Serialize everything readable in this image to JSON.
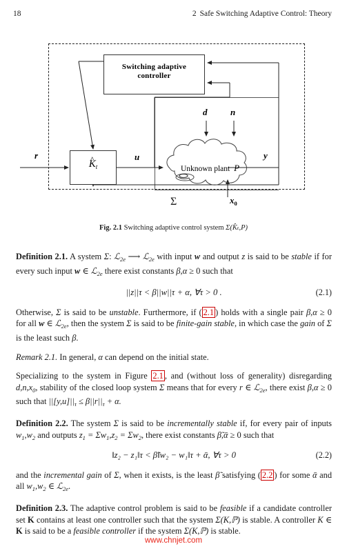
{
  "header": {
    "folio": "18",
    "chapter_number": "2",
    "chapter_title": "Safe Switching Adaptive Control: Theory"
  },
  "figure": {
    "controller_block_line1": "Switching adaptive",
    "controller_block_line2": "controller",
    "k_block_label": "K",
    "k_block_hat": "^",
    "k_block_subscript": "t",
    "plant_label": "Unknown plant",
    "plant_symbol": "P",
    "signal_r": "r",
    "signal_u": "u",
    "signal_y": "y",
    "signal_d": "d",
    "signal_n": "n",
    "signal_x0": "x",
    "signal_x0_sub": "0",
    "system_label": "Σ",
    "caption_prefix": "Fig. 2.1",
    "caption_text": "Switching adaptive control system",
    "caption_math": "Σ(K̂ₜ,P)"
  },
  "body": {
    "def21_label": "Definition 2.1.",
    "def21_text_a": "A system",
    "def21_sigma": "Σ",
    "def21_colon": ":",
    "def21_space_l2e_1": "ℒ",
    "def21_sub1": "2e",
    "def21_arrow": "⟶",
    "def21_space_l2e_2": "ℒ",
    "def21_sub2": "2e",
    "def21_text_b": "with input",
    "def21_w": "w",
    "def21_text_c": "and output",
    "def21_z": "z",
    "def21_text_d": "is said to be",
    "def21_stable": "stable",
    "def21_text_e": "if for every such input",
    "def21_text_f": "there exist constants",
    "def21_beta": "β",
    "def21_alpha": "α",
    "def21_text_g": "≥ 0 such that",
    "eq21_expr": "||z||τ < β||w||τ + α, ∀τ > 0 .",
    "eq21_tag": "(2.1)",
    "para2_a": "Otherwise,",
    "para2_b": "is said to be",
    "para2_unstable": "unstable",
    "para2_c": ". Furthermore, if",
    "para2_link": "2.1",
    "para2_d": "holds with a single pair",
    "para2_e": "for all",
    "para2_f": ", then the system",
    "para2_g": "is said to be",
    "para2_fgs": "finite-gain stable",
    "para2_h": ", in which case the",
    "para2_gain": "gain",
    "para2_i": "of",
    "para2_j": "is the least such",
    "remark_label": "Remark 2.1.",
    "remark_text_a": "In general,",
    "remark_text_b": "can depend on the initial state.",
    "para3_a": "Specializing to the system in Figure",
    "para3_link": "2.1",
    "para3_b": ", and (without loss of generality) disregarding",
    "para3_c": ", stability of the closed loop system",
    "para3_d": "means that for every",
    "para3_e": ", there exist",
    "para3_f": "such that",
    "def22_label": "Definition 2.2.",
    "def22_a": "The system",
    "def22_b": "is said to be",
    "def22_incstable": "incrementally stable",
    "def22_c": "if, for every pair of inputs",
    "def22_d": "and outputs",
    "def22_e": ", there exist constants",
    "def22_f": "≥ 0 such that",
    "eq22_expr": "‖z₂ − z₁‖τ < β̃‖w₂ − w₁‖τ + ᾱ, ∀τ > 0",
    "eq22_tag": "(2.2)",
    "para4_a": "and the",
    "para4_incremental": "incremental",
    "para4_gain": "gain",
    "para4_b": "of",
    "para4_c": ", when it exists, is the least",
    "para4_d": "satisfying",
    "para4_link": "2.2",
    "para4_e": "for some",
    "para4_f": "and all",
    "def23_label": "Definition 2.3.",
    "def23_a": "The adaptive control problem is said to be",
    "def23_feasible": "feasible",
    "def23_b": "if a candidate controller set",
    "def23_K": "K",
    "def23_c": "contains at least one controller such that the system",
    "def23_d": "is stable. A controller",
    "def23_e": "is said to be a",
    "def23_feasible_controller": "feasible controller",
    "def23_f": "if the system",
    "def23_g": "is stable."
  },
  "watermark": "www.chnjet.com",
  "colors": {
    "link": "#cc0000",
    "watermark": "#e8261b",
    "text": "#1a1a1a"
  }
}
